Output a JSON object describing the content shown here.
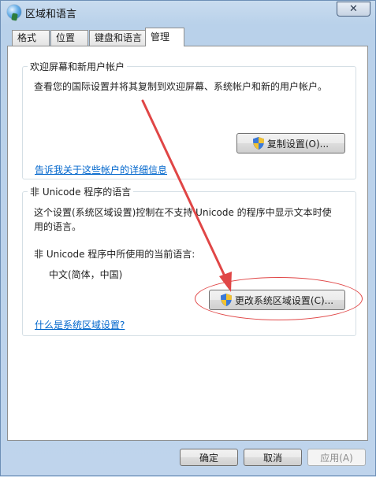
{
  "window": {
    "title": "区域和语言",
    "close_symbol": "✕"
  },
  "tabs": [
    {
      "label": "格式",
      "active": false
    },
    {
      "label": "位置",
      "active": false
    },
    {
      "label": "键盘和语言",
      "active": false
    },
    {
      "label": "管理",
      "active": true
    }
  ],
  "welcome_group": {
    "title": "欢迎屏幕和新用户帐户",
    "description": "查看您的国际设置并将其复制到欢迎屏幕、系统帐户和新的用户帐户。",
    "copy_button": "复制设置(O)...",
    "link": "告诉我关于这些帐户的详细信息"
  },
  "unicode_group": {
    "title": "非 Unicode 程序的语言",
    "description_line1": "这个设置(系统区域设置)控制在不支持 Unicode 的程序中显示文本时使",
    "description_line2": "用的语言。",
    "current_label": "非 Unicode 程序中所使用的当前语言:",
    "current_value": "中文(简体，中国)",
    "change_button": "更改系统区域设置(C)...",
    "link": "什么是系统区域设置?"
  },
  "footer": {
    "ok": "确定",
    "cancel": "取消",
    "apply": "应用(A)"
  },
  "colors": {
    "annotation_red": "#e04646",
    "link_blue": "#0066cc"
  },
  "icons": {
    "title_icon": "globe-icon",
    "button_icon": "uac-shield-icon"
  }
}
